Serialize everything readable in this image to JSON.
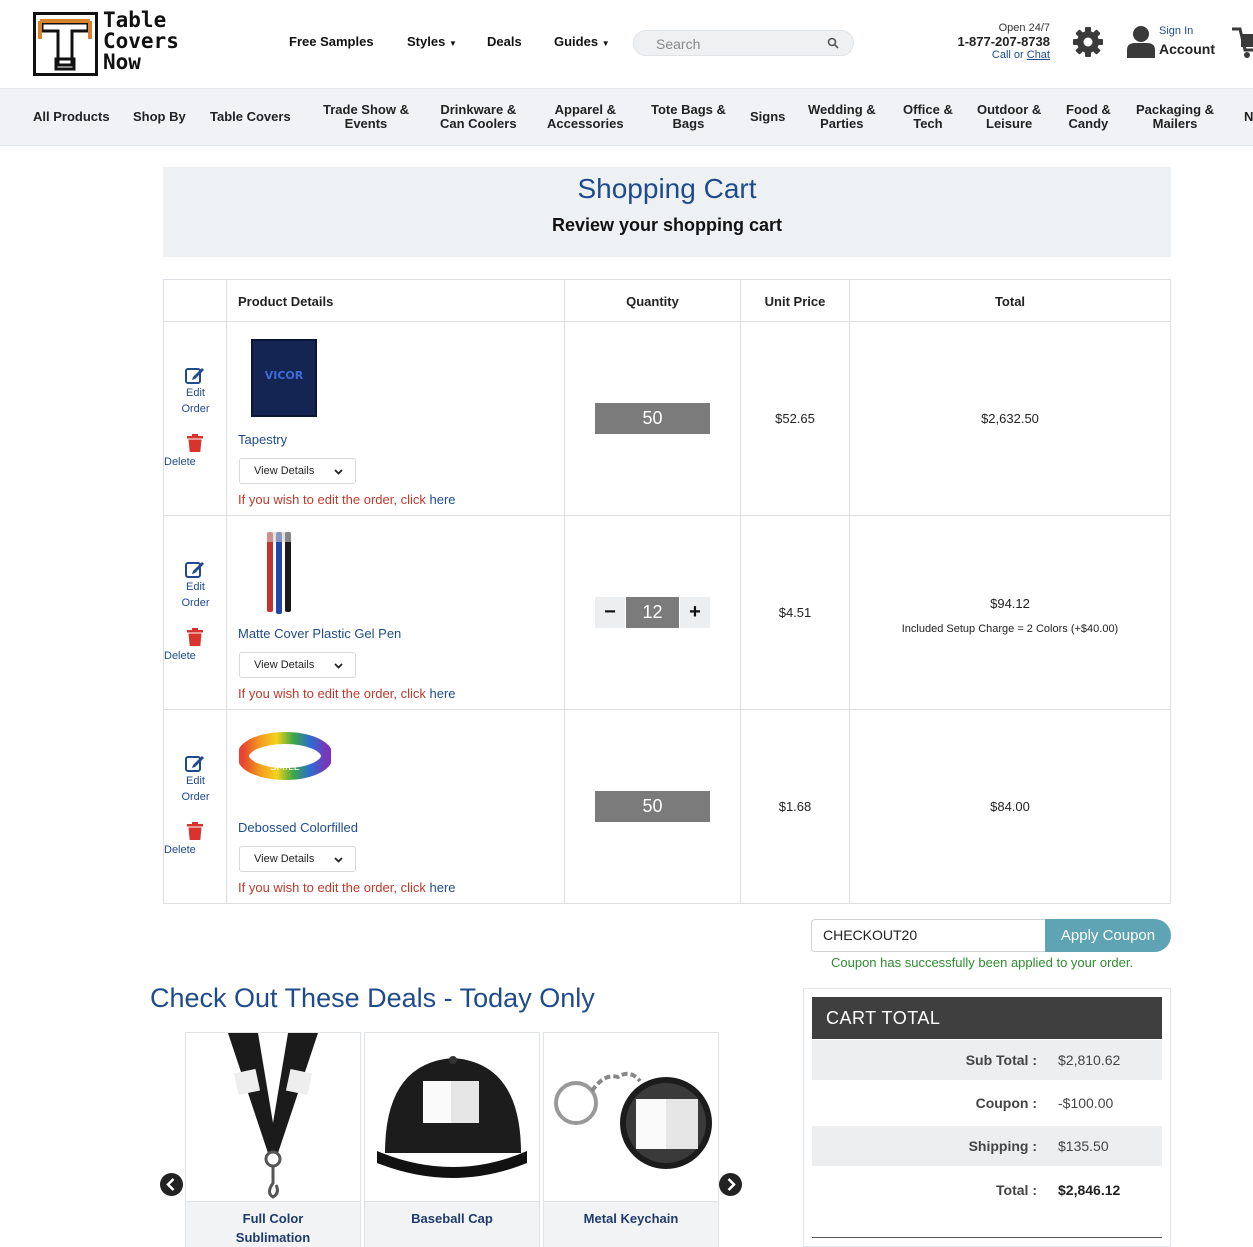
{
  "brand": {
    "logo_line1": "Table",
    "logo_line2": "Covers",
    "logo_line3": "Now",
    "accent_color": "#d9822b",
    "link_color": "#1f4b8c"
  },
  "topnav": {
    "free_samples": "Free Samples",
    "styles": "Styles",
    "deals": "Deals",
    "guides": "Guides",
    "search_placeholder": "Search",
    "open": "Open 24/7",
    "phone": "1-877-207-8738",
    "call_or": "Call or",
    "chat": "Chat",
    "sign_in": "Sign In",
    "account": "Account"
  },
  "categories": [
    {
      "l1": "All Products",
      "l2": ""
    },
    {
      "l1": "Shop By",
      "l2": ""
    },
    {
      "l1": "Table Covers",
      "l2": ""
    },
    {
      "l1": "Trade Show &",
      "l2": "Events"
    },
    {
      "l1": "Drinkware &",
      "l2": "Can Coolers"
    },
    {
      "l1": "Apparel &",
      "l2": "Accessories"
    },
    {
      "l1": "Tote Bags &",
      "l2": "Bags"
    },
    {
      "l1": "Signs",
      "l2": ""
    },
    {
      "l1": "Wedding &",
      "l2": "Parties"
    },
    {
      "l1": "Office &",
      "l2": "Tech"
    },
    {
      "l1": "Outdoor &",
      "l2": "Leisure"
    },
    {
      "l1": "Food &",
      "l2": "Candy"
    },
    {
      "l1": "Packaging &",
      "l2": "Mailers"
    },
    {
      "l1": "N",
      "l2": ""
    }
  ],
  "page": {
    "title": "Shopping Cart",
    "subtitle": "Review your shopping cart"
  },
  "table": {
    "headers": {
      "product": "Product Details",
      "quantity": "Quantity",
      "unit_price": "Unit Price",
      "total": "Total"
    },
    "edit_label_1": "Edit",
    "edit_label_2": "Order",
    "delete_label": "Delete",
    "view_details": "View Details",
    "edit_note": "If you wish to edit the order, click",
    "edit_note_link": "here",
    "items": [
      {
        "name": "Tapestry",
        "qty": "50",
        "unit_price": "$52.65",
        "total": "$2,632.50",
        "setup": "",
        "img_text": "VICOR"
      },
      {
        "name": "Matte Cover Plastic Gel Pen",
        "qty": "12",
        "unit_price": "$4.51",
        "total": "$94.12",
        "setup": "Included Setup Charge = 2 Colors (+$40.00)",
        "img_text": ""
      },
      {
        "name": "Debossed Colorfilled",
        "qty": "50",
        "unit_price": "$1.68",
        "total": "$84.00",
        "setup": "",
        "img_text": "SMILE"
      }
    ]
  },
  "coupon": {
    "code": "CHECKOUT20",
    "button": "Apply Coupon",
    "message": "Coupon has successfully been applied to your order."
  },
  "deals": {
    "title": "Check Out These Deals - Today Only",
    "items": [
      {
        "l1": "Full Color",
        "l2": "Sublimation"
      },
      {
        "l1": "Baseball Cap",
        "l2": ""
      },
      {
        "l1": "Metal Keychain",
        "l2": ""
      }
    ]
  },
  "cart_total": {
    "heading": "CART  TOTAL",
    "rows": [
      {
        "label": "Sub Total :",
        "value": "$2,810.62"
      },
      {
        "label": "Coupon :",
        "value": "-$100.00"
      },
      {
        "label": "Shipping :",
        "value": "$135.50"
      },
      {
        "label": "Total :",
        "value": "$2,846.12"
      }
    ]
  }
}
